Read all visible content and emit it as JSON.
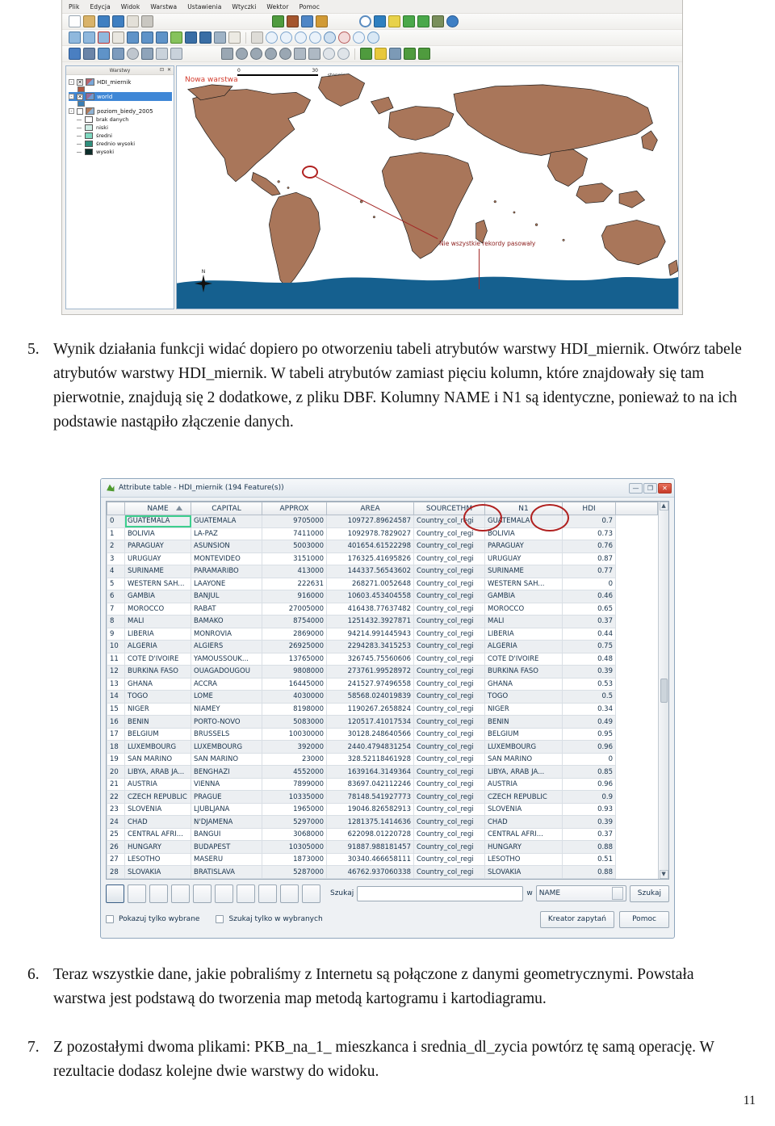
{
  "document": {
    "page_number": "11",
    "paragraphs": [
      {
        "number": "5.",
        "text": "Wynik działania funkcji widać dopiero po otworzeniu tabeli atrybutów warstwy HDI_miernik. Otwórz tabele atrybutów warstwy HDI_miernik. W tabeli atrybutów zamiast pięciu kolumn, które znajdowały się tam pierwotnie, znajdują się 2 dodatkowe, z pliku DBF. Kolumny NAME i N1 są identyczne, ponieważ to na ich podstawie nastąpiło złączenie danych."
      },
      {
        "number": "6.",
        "text": "Teraz wszystkie dane, jakie pobraliśmy z Internetu są połączone z danymi geometrycznymi. Powstała warstwa jest podstawą do tworzenia map metodą kartogramu i kartodiagramu."
      },
      {
        "number": "7.",
        "text": "Z pozostałymi dwoma plikami: PKB_na_1_ mieszkanca i srednia_dl_zycia powtórz tę samą operację. W rezultacie dodasz kolejne dwie warstwy do widoku."
      }
    ]
  },
  "qgis_window": {
    "menu": [
      "Plik",
      "Edycja",
      "Widok",
      "Warstwa",
      "Ustawienia",
      "Wtyczki",
      "Wektor",
      "Pomoc"
    ],
    "layers_panel": {
      "title": "Warstwy",
      "window_buttons": "⊡ ✕",
      "items": [
        {
          "label": "HDI_miernik",
          "checked": true,
          "selected": false,
          "swatch": "poly3"
        },
        {
          "label": "world",
          "checked": true,
          "selected": true,
          "swatch": "poly2"
        },
        {
          "label": "poziom_biedy_2005",
          "checked": false,
          "selected": false,
          "swatch": "poly"
        }
      ],
      "legend_classes": [
        {
          "label": "brak danych",
          "color": "#ffffff"
        },
        {
          "label": "niski",
          "color": "#cfeee6"
        },
        {
          "label": "średni",
          "color": "#7fd8c0"
        },
        {
          "label": "średnio wysoki",
          "color": "#2f8f7d"
        },
        {
          "label": "wysoki",
          "color": "#0d2e2b"
        }
      ]
    },
    "map": {
      "scale_min": "0",
      "scale_max": "30",
      "scale_unit": "stopnie",
      "north_label": "N",
      "annotation_new_layer": "Nowa warstwa",
      "annotation_callout": "Nie wszystkie rekordy pasowały"
    }
  },
  "attribute_table": {
    "window_title": "Attribute table - HDI_miernik (194 Feature(s))",
    "window_controls": {
      "minimize": "—",
      "maximize": "❐",
      "close": "✕"
    },
    "columns": [
      "NAME",
      "CAPITAL",
      "APPROX",
      "AREA",
      "SOURCETHM",
      "N1",
      "HDI"
    ],
    "highlighted_columns": [
      "N1",
      "HDI"
    ],
    "selected_cell": {
      "row": 0,
      "column": "NAME",
      "value": "GUATEMALA"
    },
    "rows": [
      {
        "id": "0",
        "NAME": "GUATEMALA",
        "CAPITAL": "GUATEMALA",
        "APPROX": "9705000",
        "AREA": "109727.89624587",
        "SOURCETHM": "Country_col_regi",
        "N1": "GUATEMALA",
        "HDI": "0.7"
      },
      {
        "id": "1",
        "NAME": "BOLIVIA",
        "CAPITAL": "LA-PAZ",
        "APPROX": "7411000",
        "AREA": "1092978.7829027",
        "SOURCETHM": "Country_col_regi",
        "N1": "BOLIVIA",
        "HDI": "0.73"
      },
      {
        "id": "2",
        "NAME": "PARAGUAY",
        "CAPITAL": "ASUNSION",
        "APPROX": "5003000",
        "AREA": "401654.61522298",
        "SOURCETHM": "Country_col_regi",
        "N1": "PARAGUAY",
        "HDI": "0.76"
      },
      {
        "id": "3",
        "NAME": "URUGUAY",
        "CAPITAL": "MONTEVIDEO",
        "APPROX": "3151000",
        "AREA": "176325.41695826",
        "SOURCETHM": "Country_col_regi",
        "N1": "URUGUAY",
        "HDI": "0.87"
      },
      {
        "id": "4",
        "NAME": "SURINAME",
        "CAPITAL": "PARAMARIBO",
        "APPROX": "413000",
        "AREA": "144337.56543602",
        "SOURCETHM": "Country_col_regi",
        "N1": "SURINAME",
        "HDI": "0.77"
      },
      {
        "id": "5",
        "NAME": "WESTERN SAH...",
        "CAPITAL": "LAAYONE",
        "APPROX": "222631",
        "AREA": "268271.0052648",
        "SOURCETHM": "Country_col_regi",
        "N1": "WESTERN SAH...",
        "HDI": "0"
      },
      {
        "id": "6",
        "NAME": "GAMBIA",
        "CAPITAL": "BANJUL",
        "APPROX": "916000",
        "AREA": "10603.453404558",
        "SOURCETHM": "Country_col_regi",
        "N1": "GAMBIA",
        "HDI": "0.46"
      },
      {
        "id": "7",
        "NAME": "MOROCCO",
        "CAPITAL": "RABAT",
        "APPROX": "27005000",
        "AREA": "416438.77637482",
        "SOURCETHM": "Country_col_regi",
        "N1": "MOROCCO",
        "HDI": "0.65"
      },
      {
        "id": "8",
        "NAME": "MALI",
        "CAPITAL": "BAMAKO",
        "APPROX": "8754000",
        "AREA": "1251432.3927871",
        "SOURCETHM": "Country_col_regi",
        "N1": "MALI",
        "HDI": "0.37"
      },
      {
        "id": "9",
        "NAME": "LIBERIA",
        "CAPITAL": "MONROVIA",
        "APPROX": "2869000",
        "AREA": "94214.991445943",
        "SOURCETHM": "Country_col_regi",
        "N1": "LIBERIA",
        "HDI": "0.44"
      },
      {
        "id": "10",
        "NAME": "ALGERIA",
        "CAPITAL": "ALGIERS",
        "APPROX": "26925000",
        "AREA": "2294283.3415253",
        "SOURCETHM": "Country_col_regi",
        "N1": "ALGERIA",
        "HDI": "0.75"
      },
      {
        "id": "11",
        "NAME": "COTE D'IVOIRE",
        "CAPITAL": "YAMOUSSOUK...",
        "APPROX": "13765000",
        "AREA": "326745.75560606",
        "SOURCETHM": "Country_col_regi",
        "N1": "COTE D'IVOIRE",
        "HDI": "0.48"
      },
      {
        "id": "12",
        "NAME": "BURKINA FASO",
        "CAPITAL": "OUAGADOUGOU",
        "APPROX": "9808000",
        "AREA": "273761.99528972",
        "SOURCETHM": "Country_col_regi",
        "N1": "BURKINA FASO",
        "HDI": "0.39"
      },
      {
        "id": "13",
        "NAME": "GHANA",
        "CAPITAL": "ACCRA",
        "APPROX": "16445000",
        "AREA": "241527.97496558",
        "SOURCETHM": "Country_col_regi",
        "N1": "GHANA",
        "HDI": "0.53"
      },
      {
        "id": "14",
        "NAME": "TOGO",
        "CAPITAL": "LOME",
        "APPROX": "4030000",
        "AREA": "58568.024019839",
        "SOURCETHM": "Country_col_regi",
        "N1": "TOGO",
        "HDI": "0.5"
      },
      {
        "id": "15",
        "NAME": "NIGER",
        "CAPITAL": "NIAMEY",
        "APPROX": "8198000",
        "AREA": "1190267.2658824",
        "SOURCETHM": "Country_col_regi",
        "N1": "NIGER",
        "HDI": "0.34"
      },
      {
        "id": "16",
        "NAME": "BENIN",
        "CAPITAL": "PORTO-NOVO",
        "APPROX": "5083000",
        "AREA": "120517.41017534",
        "SOURCETHM": "Country_col_regi",
        "N1": "BENIN",
        "HDI": "0.49"
      },
      {
        "id": "17",
        "NAME": "BELGIUM",
        "CAPITAL": "BRUSSELS",
        "APPROX": "10030000",
        "AREA": "30128.248640566",
        "SOURCETHM": "Country_col_regi",
        "N1": "BELGIUM",
        "HDI": "0.95"
      },
      {
        "id": "18",
        "NAME": "LUXEMBOURG",
        "CAPITAL": "LUXEMBOURG",
        "APPROX": "392000",
        "AREA": "2440.4794831254",
        "SOURCETHM": "Country_col_regi",
        "N1": "LUXEMBOURG",
        "HDI": "0.96"
      },
      {
        "id": "19",
        "NAME": "SAN MARINO",
        "CAPITAL": "SAN MARINO",
        "APPROX": "23000",
        "AREA": "328.52118461928",
        "SOURCETHM": "Country_col_regi",
        "N1": "SAN MARINO",
        "HDI": "0"
      },
      {
        "id": "20",
        "NAME": "LIBYA, ARAB JA...",
        "CAPITAL": "BENGHAZI",
        "APPROX": "4552000",
        "AREA": "1639164.3149364",
        "SOURCETHM": "Country_col_regi",
        "N1": "LIBYA, ARAB JA...",
        "HDI": "0.85"
      },
      {
        "id": "21",
        "NAME": "AUSTRIA",
        "CAPITAL": "VIENNA",
        "APPROX": "7899000",
        "AREA": "83697.042112246",
        "SOURCETHM": "Country_col_regi",
        "N1": "AUSTRIA",
        "HDI": "0.96"
      },
      {
        "id": "22",
        "NAME": "CZECH REPUBLIC",
        "CAPITAL": "PRAGUE",
        "APPROX": "10335000",
        "AREA": "78148.541927773",
        "SOURCETHM": "Country_col_regi",
        "N1": "CZECH REPUBLIC",
        "HDI": "0.9"
      },
      {
        "id": "23",
        "NAME": "SLOVENIA",
        "CAPITAL": "LJUBLJANA",
        "APPROX": "1965000",
        "AREA": "19046.826582913",
        "SOURCETHM": "Country_col_regi",
        "N1": "SLOVENIA",
        "HDI": "0.93"
      },
      {
        "id": "24",
        "NAME": "CHAD",
        "CAPITAL": "N'DJAMENA",
        "APPROX": "5297000",
        "AREA": "1281375.1414636",
        "SOURCETHM": "Country_col_regi",
        "N1": "CHAD",
        "HDI": "0.39"
      },
      {
        "id": "25",
        "NAME": "CENTRAL AFRI...",
        "CAPITAL": "BANGUI",
        "APPROX": "3068000",
        "AREA": "622098.01220728",
        "SOURCETHM": "Country_col_regi",
        "N1": "CENTRAL AFRI...",
        "HDI": "0.37"
      },
      {
        "id": "26",
        "NAME": "HUNGARY",
        "CAPITAL": "BUDAPEST",
        "APPROX": "10305000",
        "AREA": "91887.988181457",
        "SOURCETHM": "Country_col_regi",
        "N1": "HUNGARY",
        "HDI": "0.88"
      },
      {
        "id": "27",
        "NAME": "LESOTHO",
        "CAPITAL": "MASERU",
        "APPROX": "1873000",
        "AREA": "30340.466658111",
        "SOURCETHM": "Country_col_regi",
        "N1": "LESOTHO",
        "HDI": "0.51"
      },
      {
        "id": "28",
        "NAME": "SLOVAKIA",
        "CAPITAL": "BRATISLAVA",
        "APPROX": "5287000",
        "AREA": "46762.937060338",
        "SOURCETHM": "Country_col_regi",
        "N1": "SLOVAKIA",
        "HDI": "0.88"
      }
    ],
    "footer": {
      "search_label": "Szukaj",
      "search_value": "",
      "in_label": "w",
      "field_selected": "NAME",
      "search_button": "Szukaj",
      "checkbox_show_selected": "Pokazuj tylko wybrane",
      "checkbox_search_selected": "Szukaj tylko w wybranych",
      "query_builder_button": "Kreator zapytań",
      "help_button": "Pomoc"
    }
  }
}
